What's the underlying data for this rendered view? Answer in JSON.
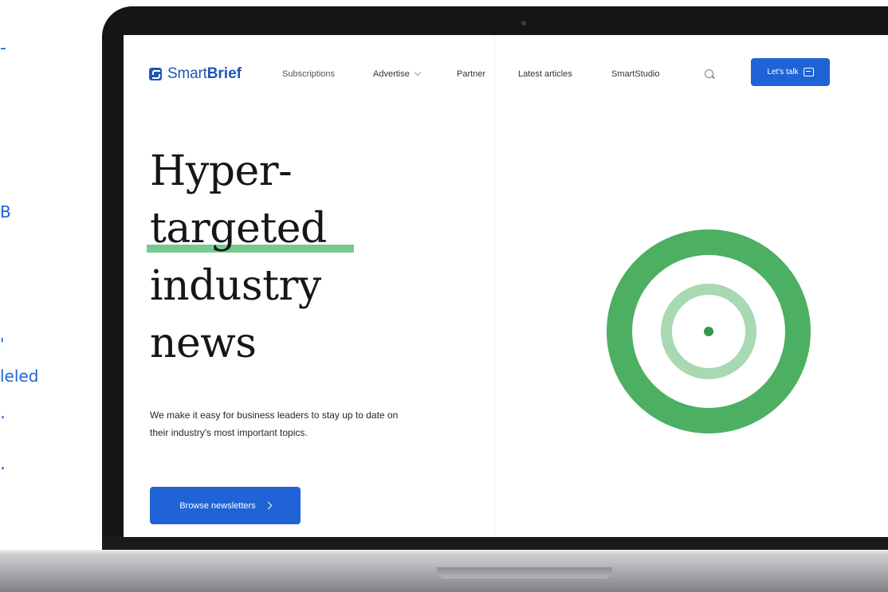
{
  "left_fragments": [
    "-",
    "B",
    "'",
    "leled",
    ".",
    "."
  ],
  "nav": {
    "logo_smart": "Smart",
    "logo_brief": "Brief",
    "items": [
      "Subscriptions",
      "Advertise",
      "Partner",
      "Latest articles",
      "SmartStudio"
    ],
    "cta": "Let's talk"
  },
  "hero": {
    "title_lines": [
      "Hyper-",
      "targeted",
      "industry",
      "news"
    ],
    "subtitle": "We make it easy for business leaders to stay up to date on their industry's most important topics.",
    "button": "Browse newsletters"
  },
  "colors": {
    "accent": "#1f63d6",
    "green_ring": "#4caf62",
    "green_light": "#a8d9b2",
    "green_dot": "#2e9b4a"
  },
  "icons": [
    "logo-mark-icon",
    "chevron-down-icon",
    "search-icon",
    "chat-icon",
    "chevron-right-icon"
  ]
}
